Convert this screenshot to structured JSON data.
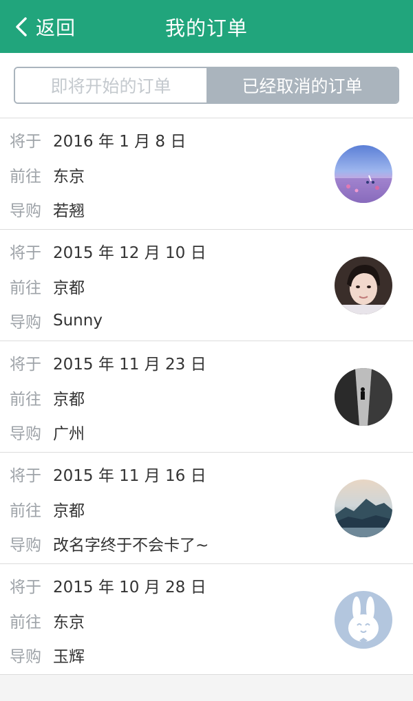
{
  "header": {
    "back_label": "返回",
    "title": "我的订单"
  },
  "tabs": [
    {
      "label": "即将开始的订单",
      "active": false
    },
    {
      "label": "已经取消的订单",
      "active": true
    }
  ],
  "labels": {
    "date": "将于",
    "destination": "前往",
    "guide": "导购"
  },
  "orders": [
    {
      "date": "2016 年 1 月 8 日",
      "destination": "东京",
      "guide": "若翘",
      "avatar": "bicycle-flower-field-avatar"
    },
    {
      "date": "2015 年 12 月 10 日",
      "destination": "京都",
      "guide": "Sunny",
      "avatar": "woman-portrait-avatar"
    },
    {
      "date": "2015 年 11 月 23 日",
      "destination": "京都",
      "guide": "广州",
      "avatar": "bw-alley-avatar"
    },
    {
      "date": "2015 年 11 月 16 日",
      "destination": "京都",
      "guide": "改名字终于不会卡了~",
      "avatar": "mountain-lake-avatar"
    },
    {
      "date": "2015 年 10 月 28 日",
      "destination": "东京",
      "guide": "玉辉",
      "avatar": "rabbit-default-avatar"
    }
  ],
  "colors": {
    "header_bg": "#21a57c",
    "tab_active_bg": "#aab4bd",
    "tab_inactive_text": "#c4c9ce",
    "label_text": "#9ea3a8",
    "value_text": "#333333"
  }
}
